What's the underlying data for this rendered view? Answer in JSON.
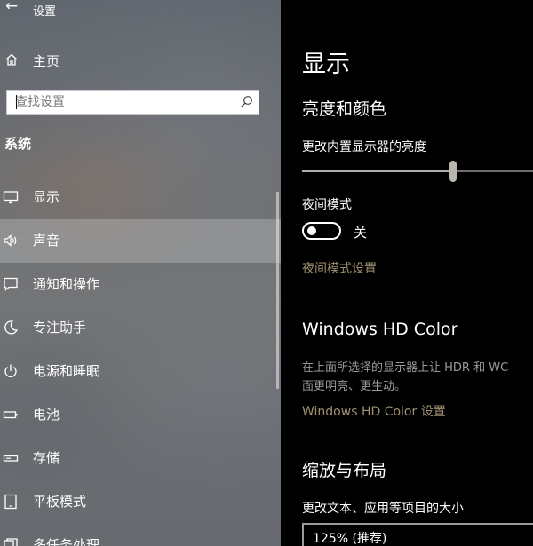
{
  "window": {
    "title": "设置",
    "back_icon": "back-arrow-icon"
  },
  "sidebar": {
    "home": {
      "label": "主页",
      "icon": "home-icon"
    },
    "search": {
      "placeholder": "查找设置",
      "value": "",
      "icon": "search-icon"
    },
    "section_title": "系统",
    "items": [
      {
        "label": "显示",
        "icon": "display-icon",
        "selected": false
      },
      {
        "label": "声音",
        "icon": "speaker-icon",
        "selected": true
      },
      {
        "label": "通知和操作",
        "icon": "notification-icon",
        "selected": false
      },
      {
        "label": "专注助手",
        "icon": "moon-icon",
        "selected": false
      },
      {
        "label": "电源和睡眠",
        "icon": "power-icon",
        "selected": false
      },
      {
        "label": "电池",
        "icon": "battery-icon",
        "selected": false
      },
      {
        "label": "存储",
        "icon": "storage-icon",
        "selected": false
      },
      {
        "label": "平板模式",
        "icon": "tablet-icon",
        "selected": false
      },
      {
        "label": "多任务处理",
        "icon": "multitask-icon",
        "selected": false
      }
    ]
  },
  "content": {
    "title": "显示",
    "brightness_section": {
      "heading": "亮度和颜色",
      "slider_label": "更改内置显示器的亮度",
      "slider_value_fraction": 0.63
    },
    "night_mode": {
      "label": "夜间模式",
      "state_label": "关",
      "on": false,
      "settings_link": "夜间模式设置"
    },
    "hd_color": {
      "heading": "Windows HD Color",
      "description_line1": "在上面所选择的显示器上让 HDR 和 WC",
      "description_line2": "面更明亮、更生动。",
      "settings_link": "Windows HD Color 设置"
    },
    "scale_section": {
      "heading": "缩放与布局",
      "label": "更改文本、应用等项目的大小",
      "selected_value": "125% (推荐)"
    }
  },
  "colors": {
    "link": "#a09070",
    "content_bg": "#000000",
    "selected_item_bg": "rgba(255,255,255,0.22)"
  }
}
